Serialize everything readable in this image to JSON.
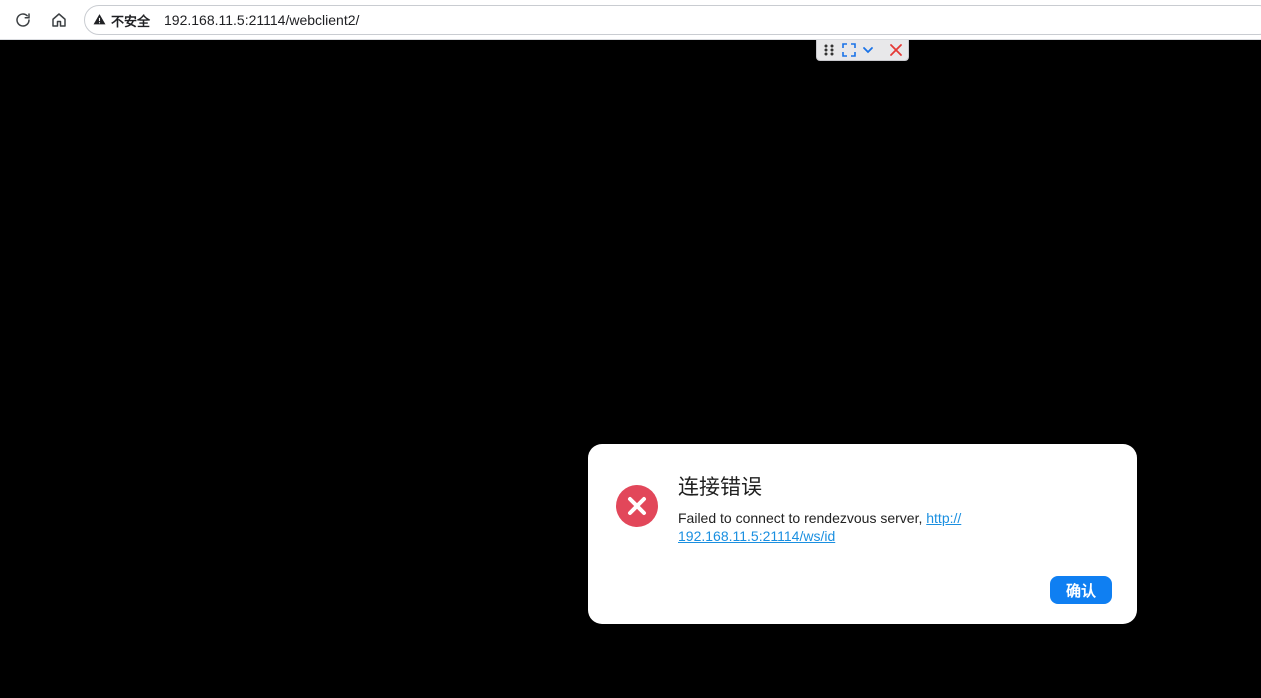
{
  "browser": {
    "security_label": "不安全",
    "url": "192.168.11.5:21114/webclient2/"
  },
  "toolbar": {
    "icons": [
      "drag-handle-icon",
      "fullscreen-icon",
      "chevron-down-icon",
      "close-icon"
    ],
    "accent_color": "#1a73e8",
    "close_color": "#e53935"
  },
  "dialog": {
    "title": "连接错误",
    "message_prefix": "Failed to connect to rendezvous server, ",
    "link_line1": "http://",
    "link_line2": "192.168.11.5:21114/ws/id",
    "confirm_label": "确认",
    "error_color": "#e2475a",
    "button_color": "#0f7ff2"
  }
}
